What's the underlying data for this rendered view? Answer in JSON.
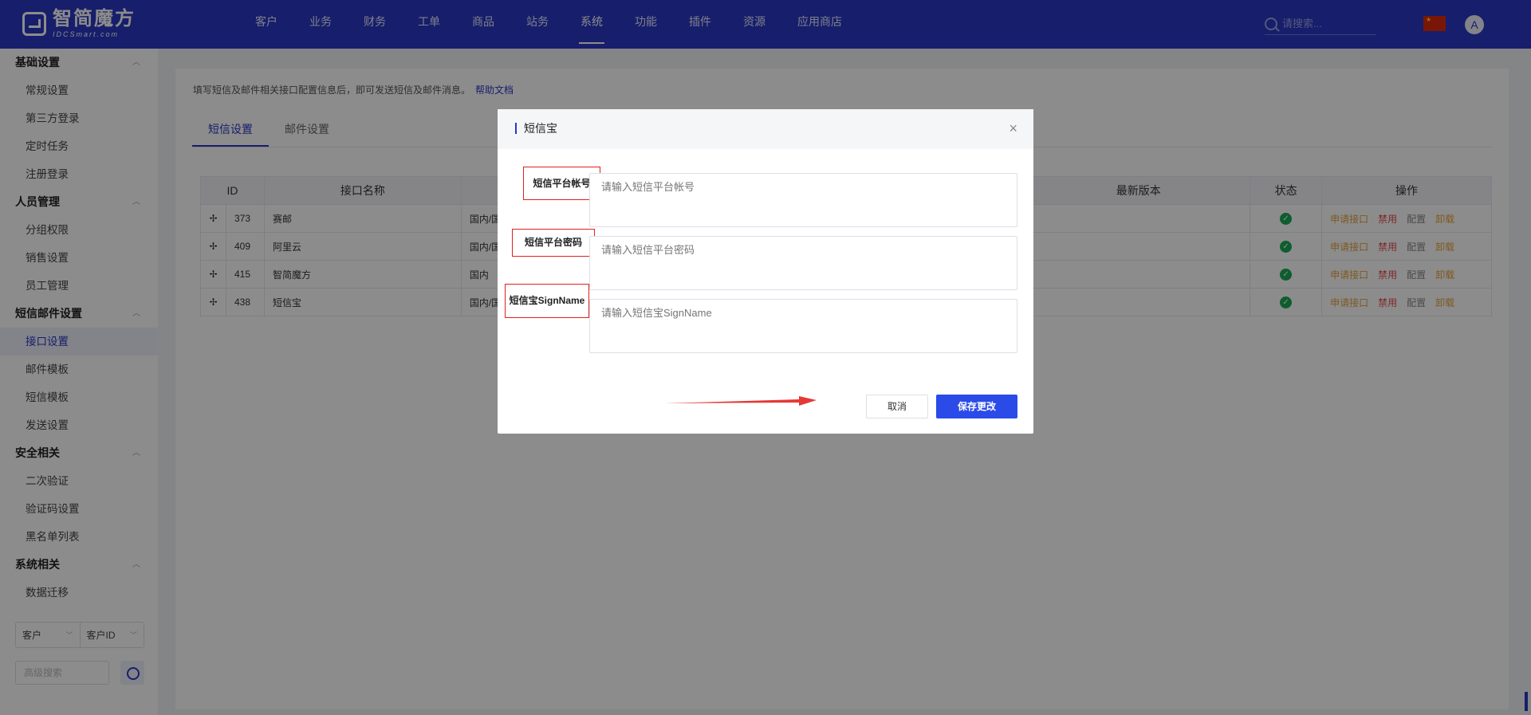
{
  "logo": {
    "cn": "智简魔方",
    "en": "IDCSmart.com"
  },
  "topnav": {
    "items": [
      {
        "label": "客户"
      },
      {
        "label": "业务"
      },
      {
        "label": "财务"
      },
      {
        "label": "工单"
      },
      {
        "label": "商品"
      },
      {
        "label": "站务"
      },
      {
        "label": "系统",
        "active": true
      },
      {
        "label": "功能"
      },
      {
        "label": "插件"
      },
      {
        "label": "资源"
      },
      {
        "label": "应用商店"
      }
    ],
    "search_placeholder": "请搜索...",
    "avatar_letter": "A"
  },
  "sidebar": {
    "groups": [
      {
        "title": "基础设置",
        "items": [
          "常规设置",
          "第三方登录",
          "定时任务",
          "注册登录"
        ]
      },
      {
        "title": "人员管理",
        "items": [
          "分组权限",
          "销售设置",
          "员工管理"
        ]
      },
      {
        "title": "短信邮件设置",
        "items": [
          "接口设置",
          "邮件模板",
          "短信模板",
          "发送设置"
        ]
      },
      {
        "title": "安全相关",
        "items": [
          "二次验证",
          "验证码设置",
          "黑名单列表"
        ]
      },
      {
        "title": "系统相关",
        "items": [
          "数据迁移"
        ]
      }
    ],
    "active_item": "接口设置",
    "filter": {
      "select1": "客户",
      "select2": "客户ID",
      "adv_placeholder": "高级搜索"
    }
  },
  "main": {
    "notice": "填写短信及邮件相关接口配置信息后，即可发送短信及邮件消息。",
    "help_link": "帮助文档",
    "tabs": [
      {
        "label": "短信设置",
        "active": true
      },
      {
        "label": "邮件设置"
      }
    ],
    "table": {
      "headers": [
        "ID",
        "接口名称",
        "最新版本",
        "状态",
        "操作"
      ],
      "rows": [
        {
          "id": "373",
          "name": "赛邮",
          "region": "国内/国"
        },
        {
          "id": "409",
          "name": "阿里云",
          "region": "国内/国"
        },
        {
          "id": "415",
          "name": "智简魔方",
          "region": "国内"
        },
        {
          "id": "438",
          "name": "短信宝",
          "region": "国内/国"
        }
      ],
      "actions": [
        "申请接口",
        "禁用",
        "配置",
        "卸载"
      ]
    }
  },
  "dialog": {
    "title": "短信宝",
    "fields": [
      {
        "label": "短信平台帐号",
        "placeholder": "请输入短信平台帐号"
      },
      {
        "label": "短信平台密码",
        "placeholder": "请输入短信平台密码"
      },
      {
        "label": "短信宝SignName",
        "placeholder": "请输入短信宝SignName"
      }
    ],
    "cancel_label": "取消",
    "save_label": "保存更改"
  },
  "colors": {
    "brand": "#2a37c4",
    "save_button": "#2a4be8",
    "highlight_box": "#e02020",
    "annotation_arrow": "#e53935"
  }
}
